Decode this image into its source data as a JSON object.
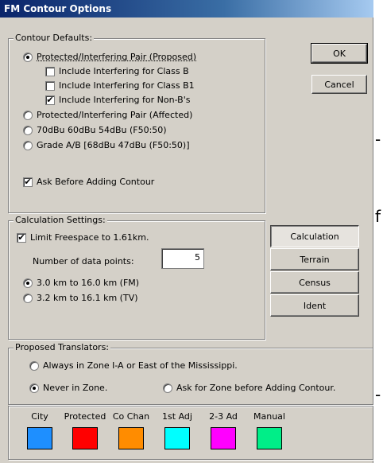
{
  "window": {
    "title": "FM Contour Options"
  },
  "contour_defaults": {
    "legend": "Contour Defaults:",
    "option_protected_interfering": "Protected/Interfering Pair (Proposed)",
    "include_class_b": "Include Interfering for Class B",
    "include_class_b1": "Include Interfering for Class B1",
    "include_non_b": "Include Interfering for Non-B's",
    "option_protected_affected": "Protected/Interfering Pair (Affected)",
    "option_70dbu": "70dBu 60dBu 54dBu (F50:50)",
    "option_grade_ab": "Grade A/B [68dBu 47dBu (F50:50)]",
    "ask_before_adding": "Ask Before Adding Contour"
  },
  "buttons": {
    "ok": "OK",
    "cancel": "Cancel"
  },
  "calculation_settings": {
    "legend": "Calculation Settings:",
    "limit_freespace": "Limit Freespace to 1.61km.",
    "data_points_label": "Number of data points:",
    "data_points_value": "5",
    "range_fm": "3.0 km to 16.0 km (FM)",
    "range_tv": "3.2 km to 16.1 km (TV)"
  },
  "side_tabs": {
    "calculation": "Calculation",
    "terrain": "Terrain",
    "census": "Census",
    "ident": "Ident"
  },
  "proposed_translators": {
    "legend": "Proposed Translators:",
    "always_zone": "Always in Zone I-A or East of the Mississippi.",
    "never_zone": "Never in Zone.",
    "ask_zone": "Ask for Zone before Adding Contour."
  },
  "colors": {
    "city": {
      "label": "City",
      "color": "#1e8fff"
    },
    "protected": {
      "label": "Protected",
      "color": "#ff0000"
    },
    "co_chan": {
      "label": "Co Chan",
      "color": "#ff8c00"
    },
    "first_adj": {
      "label": "1st Adj",
      "color": "#00ffff"
    },
    "adj_2_3": {
      "label": "2-3 Ad",
      "color": "#ff00ff"
    },
    "manual": {
      "label": "Manual",
      "color": "#00ee88"
    }
  },
  "gutter": {
    "mark1": "-",
    "mark2": "f",
    "mark3": "-"
  }
}
